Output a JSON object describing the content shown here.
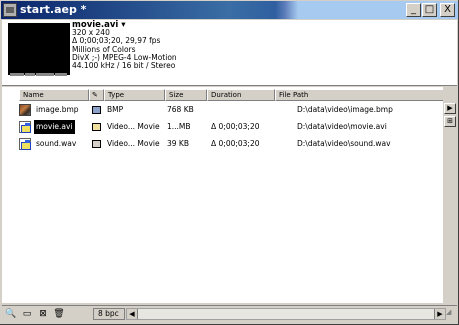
{
  "window": {
    "title": "start.aep *",
    "icons": {
      "app": "project-window-icon",
      "minimize": "minimize-icon",
      "maximize": "maximize-icon",
      "close": "close-icon"
    },
    "minimize_glyph": "_",
    "maximize_glyph": "□",
    "close_glyph": "X"
  },
  "preview": {
    "name": "movie.avi ▾",
    "lines": [
      "320 x 240",
      "Δ 0;00;03;20, 29,97 fps",
      "Millions of Colors",
      "DivX ;-) MPEG-4 Low-Motion",
      "44.100 kHz / 16 bit / Stereo"
    ]
  },
  "table": {
    "columns": {
      "name": "Name",
      "label": "✎",
      "type": "Type",
      "size": "Size",
      "duration": "Duration",
      "path": "File Path"
    },
    "rows": [
      {
        "icon": "image-file-icon",
        "name": "image.bmp",
        "label_color": "#8ca0c8",
        "type": "BMP",
        "size": "768 KB",
        "duration": "",
        "path": "D:\\data\\video\\image.bmp",
        "selected": false
      },
      {
        "icon": "video-file-icon",
        "name": "movie.avi",
        "label_color": "#f0e0a0",
        "type": "Video... Movie",
        "size": "1...MB",
        "duration": "Δ 0;00;03;20",
        "path": "D:\\data\\video\\movie.avi",
        "selected": true
      },
      {
        "icon": "audio-file-icon",
        "name": "sound.wav",
        "label_color": "#d4d0c8",
        "type": "Video... Movie",
        "size": "39 KB",
        "duration": "Δ 0;00;03;20",
        "path": "D:\\data\\video\\sound.wav",
        "selected": false
      }
    ]
  },
  "side": {
    "arrow": "▶",
    "flowchart_glyph": "⊞"
  },
  "bottombar": {
    "find_glyph": "🔍",
    "folder_glyph": "▭",
    "comp_glyph": "⊠",
    "trash_glyph": "🗑",
    "bpc_label": "8 bpc",
    "left_arrow": "◀",
    "right_arrow": "▶",
    "resize_glyph": "◢"
  }
}
